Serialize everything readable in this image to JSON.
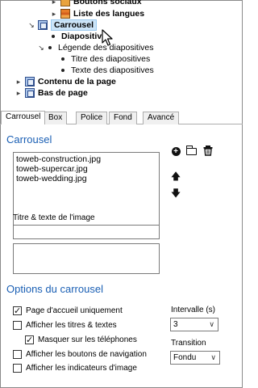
{
  "tree": {
    "nodes": [
      {
        "label": "Boutons sociaux",
        "expander": "closed",
        "icon": "social-icon"
      },
      {
        "label": "Liste des langues",
        "expander": "closed",
        "icon": "books-icon"
      },
      {
        "label": "Carrousel",
        "expander": "open",
        "icon": "filmstrip-icon",
        "selected": true
      },
      {
        "label": "Diapositive",
        "expander": "none"
      },
      {
        "label": "Légende des diapositives",
        "expander": "open"
      },
      {
        "label": "Titre des diapositives",
        "expander": "none"
      },
      {
        "label": "Texte des diapositives",
        "expander": "none"
      },
      {
        "label": "Contenu de la page",
        "expander": "closed",
        "icon": "filmstrip-icon"
      },
      {
        "label": "Bas de page",
        "expander": "closed",
        "icon": "filmstrip-icon"
      }
    ]
  },
  "tabs": [
    {
      "label": "Carrousel",
      "active": true
    },
    {
      "label": "Box"
    },
    {
      "label": "Police"
    },
    {
      "label": "Fond"
    },
    {
      "label": "Avancé"
    }
  ],
  "carousel": {
    "title": "Carrousel",
    "images": [
      "toweb-construction.jpg",
      "toweb-supercar.jpg",
      "toweb-wedding.jpg"
    ],
    "caption_label": "Titre & texte de l'image",
    "caption_title_value": "",
    "caption_text_value": ""
  },
  "options": {
    "title": "Options du carrousel",
    "checkboxes": [
      {
        "label": "Page d'accueil uniquement",
        "checked": true
      },
      {
        "label": "Afficher les titres & textes",
        "checked": false
      },
      {
        "label": "Masquer sur les téléphones",
        "checked": true
      },
      {
        "label": "Afficher les boutons de navigation",
        "checked": false
      },
      {
        "label": "Afficher les indicateurs d'image",
        "checked": false
      }
    ],
    "interval_label": "Intervalle (s)",
    "interval_value": "3",
    "transition_label": "Transition",
    "transition_value": "Fondu"
  },
  "colors": {
    "accent": "#1a5fb4",
    "selection": "#cce4f7"
  }
}
